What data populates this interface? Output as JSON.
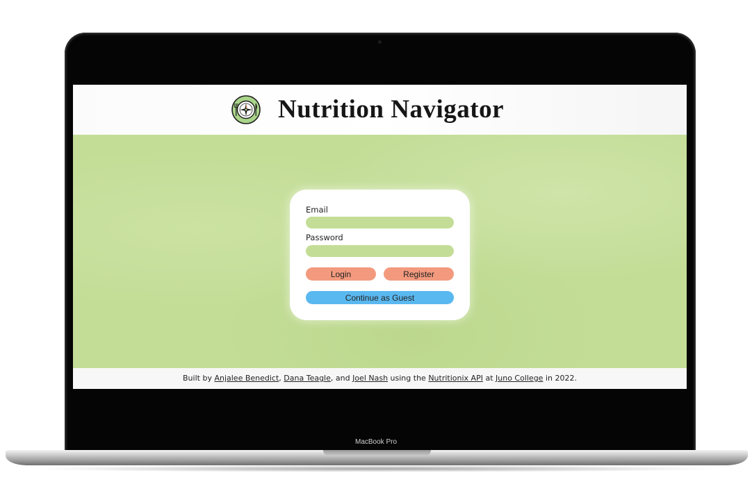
{
  "device": {
    "label": "MacBook Pro"
  },
  "header": {
    "title": "Nutrition Navigator",
    "logo_icon": "plate-compass-icon"
  },
  "login_form": {
    "email_label": "Email",
    "email_value": "",
    "password_label": "Password",
    "password_value": "",
    "login_label": "Login",
    "register_label": "Register",
    "guest_label": "Continue as Guest"
  },
  "footer": {
    "prefix": "Built by ",
    "author_1": "Anjalee Benedict",
    "sep_1": ", ",
    "author_2": "Dana Teagle",
    "sep_2": ", and ",
    "author_3": "Joel Nash",
    "mid_1": " using the ",
    "api_link": "Nutritionix API",
    "mid_2": " at ",
    "school_link": "Juno College",
    "suffix": " in 2022."
  },
  "colors": {
    "accent_green": "#c3dd97",
    "button_salmon": "#f39a7e",
    "button_blue": "#5ab8f0"
  }
}
